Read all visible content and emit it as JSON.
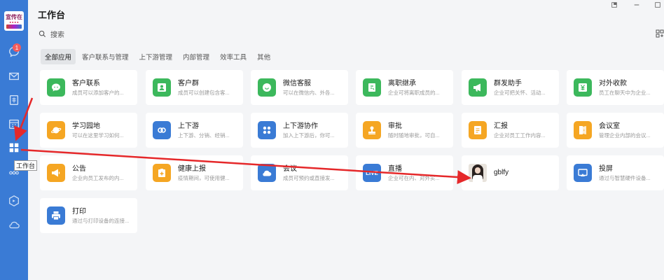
{
  "sidebar": {
    "badge_count": "1",
    "tooltip": "工作台",
    "avatar_text": "宣传在"
  },
  "header": {
    "title": "工作台",
    "search_placeholder": "搜索"
  },
  "tabs": [
    {
      "label": "全部应用",
      "active": true
    },
    {
      "label": "客户联系与管理",
      "active": false
    },
    {
      "label": "上下游管理",
      "active": false
    },
    {
      "label": "内部管理",
      "active": false
    },
    {
      "label": "效率工具",
      "active": false
    },
    {
      "label": "其他",
      "active": false
    }
  ],
  "apps": [
    {
      "name": "客户联系",
      "desc": "成员可以添加客户的...",
      "color": "#3cb85c",
      "icon": "chat-icon"
    },
    {
      "name": "客户群",
      "desc": "成员可以创建包含客...",
      "color": "#3cb85c",
      "icon": "group-icon"
    },
    {
      "name": "微信客服",
      "desc": "可以在微信内、外各...",
      "color": "#3cb85c",
      "icon": "service-icon"
    },
    {
      "name": "离职继承",
      "desc": "企业可将离职成员的...",
      "color": "#3cb85c",
      "icon": "handover-icon"
    },
    {
      "name": "群发助手",
      "desc": "企业可把关怀、活动...",
      "color": "#3cb85c",
      "icon": "megaphone-icon"
    },
    {
      "name": "对外收款",
      "desc": "员工在聊天中为企业...",
      "color": "#3cb85c",
      "icon": "yuan-icon"
    },
    {
      "name": "学习园地",
      "desc": "可以在这里学习如何...",
      "color": "#f5a623",
      "icon": "planet-icon"
    },
    {
      "name": "上下游",
      "desc": "上下游、分销、经销...",
      "color": "#3a7bd5",
      "icon": "link-icon"
    },
    {
      "name": "上下游协作",
      "desc": "加入上下游后，你可...",
      "color": "#3a7bd5",
      "icon": "apps-icon"
    },
    {
      "name": "审批",
      "desc": "随时随地审批，可自...",
      "color": "#f5a623",
      "icon": "stamp-icon"
    },
    {
      "name": "汇报",
      "desc": "企业对员工工作内容...",
      "color": "#f5a623",
      "icon": "report-icon"
    },
    {
      "name": "会议室",
      "desc": "管理企业内部的会议...",
      "color": "#f5a623",
      "icon": "door-icon"
    },
    {
      "name": "公告",
      "desc": "企业向员工发布的内...",
      "color": "#f5a623",
      "icon": "announce-icon"
    },
    {
      "name": "健康上报",
      "desc": "疫情期间，可使用健...",
      "color": "#f5a623",
      "icon": "health-icon"
    },
    {
      "name": "会议",
      "desc": "成员可预约或直接发...",
      "color": "#3a7bd5",
      "icon": "cloud-icon"
    },
    {
      "name": "直播",
      "desc": "企业可在内、对外实...",
      "color": "#3a7bd5",
      "icon": "live-icon"
    },
    {
      "name": "gblfy",
      "desc": "",
      "color": "",
      "icon": "photo-avatar"
    },
    {
      "name": "投屏",
      "desc": "通过与智慧硬件设备...",
      "color": "#3a7bd5",
      "icon": "cast-icon"
    },
    {
      "name": "打印",
      "desc": "通过与打印设备的连接...",
      "color": "#3a7bd5",
      "icon": "printer-icon"
    }
  ],
  "live_label": "LIVE"
}
